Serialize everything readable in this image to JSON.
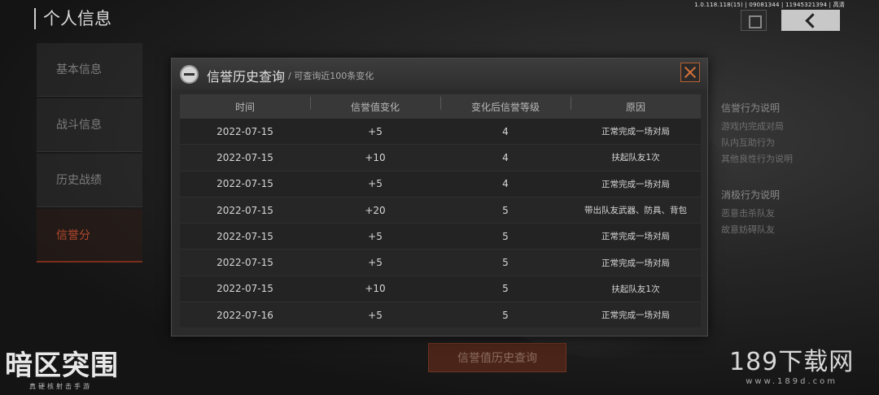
{
  "build_info": "1.0.118.118(15) | 09081344 | 11945321394 | 高清",
  "page": {
    "title": "个人信息"
  },
  "sidebar": {
    "items": [
      {
        "label": "基本信息"
      },
      {
        "label": "战斗信息"
      },
      {
        "label": "历史战绩"
      },
      {
        "label": "信誉分",
        "active": true
      }
    ]
  },
  "right_panel": {
    "sections": [
      {
        "heading": "信誉行为说明",
        "lines": [
          "游戏内完成对局",
          "队内互助行为",
          "其他良性行为说明"
        ]
      },
      {
        "heading": "消极行为说明",
        "lines": [
          "恶意击杀队友",
          "故意妨碍队友"
        ]
      }
    ]
  },
  "bottom_button": {
    "label": "信誉值历史查询"
  },
  "logo": {
    "title": "暗区突围",
    "subtitle": "真硬核射击手游"
  },
  "watermark": {
    "title": "189下载网",
    "url": "www.189d.com"
  },
  "modal": {
    "title": "信誉历史查询",
    "subtitle": "/ 可查询近100条变化",
    "columns": [
      "时间",
      "信誉值变化",
      "变化后信誉等级",
      "原因"
    ],
    "rows": [
      {
        "date": "2022-07-15",
        "change": "+5",
        "level": "4",
        "reason": "正常完成一场对局"
      },
      {
        "date": "2022-07-15",
        "change": "+10",
        "level": "4",
        "reason": "扶起队友1次"
      },
      {
        "date": "2022-07-15",
        "change": "+5",
        "level": "4",
        "reason": "正常完成一场对局"
      },
      {
        "date": "2022-07-15",
        "change": "+20",
        "level": "5",
        "reason": "带出队友武器、防具、背包"
      },
      {
        "date": "2022-07-15",
        "change": "+5",
        "level": "5",
        "reason": "正常完成一场对局"
      },
      {
        "date": "2022-07-15",
        "change": "+5",
        "level": "5",
        "reason": "正常完成一场对局"
      },
      {
        "date": "2022-07-15",
        "change": "+10",
        "level": "5",
        "reason": "扶起队友1次"
      },
      {
        "date": "2022-07-16",
        "change": "+5",
        "level": "5",
        "reason": "正常完成一场对局"
      }
    ]
  },
  "colors": {
    "accent": "#d2703a",
    "active_nav": "#b5492c",
    "button_bg": "#4a2418"
  }
}
